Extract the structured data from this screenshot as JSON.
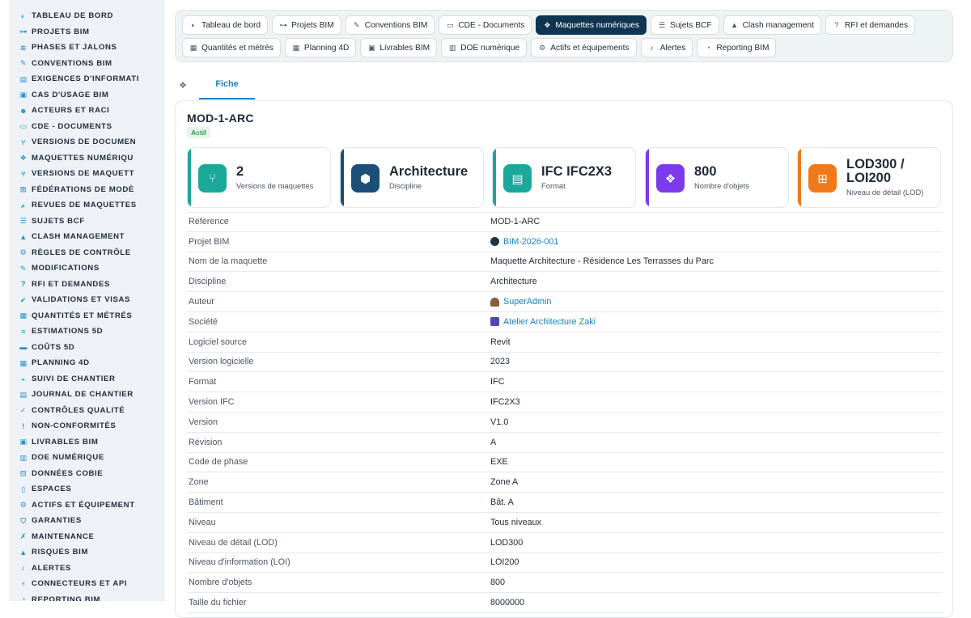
{
  "sidebar": {
    "items": [
      {
        "label": "TABLEAU DE BORD",
        "icon": "dashboard-icon",
        "glyph": "◐"
      },
      {
        "label": "PROJETS BIM",
        "icon": "project-tree-icon",
        "glyph": "⊶"
      },
      {
        "label": "PHASES ET JALONS",
        "icon": "layers-icon",
        "glyph": "≋"
      },
      {
        "label": "CONVENTIONS BIM",
        "icon": "document-sign-icon",
        "glyph": "✎"
      },
      {
        "label": "EXIGENCES D'INFORMATI",
        "icon": "clipboard-icon",
        "glyph": "▤"
      },
      {
        "label": "CAS D'USAGE BIM",
        "icon": "folder-icon",
        "glyph": "▣"
      },
      {
        "label": "ACTEURS ET RACI",
        "icon": "users-icon",
        "glyph": "☻"
      },
      {
        "label": "CDE - DOCUMENTS",
        "icon": "folder-open-icon",
        "glyph": "▭"
      },
      {
        "label": "VERSIONS DE DOCUMEN",
        "icon": "branch-icon",
        "glyph": "⑂"
      },
      {
        "label": "MAQUETTES NUMÉRIQU",
        "icon": "cubes-icon",
        "glyph": "❖"
      },
      {
        "label": "VERSIONS DE MAQUETT",
        "icon": "branch-icon",
        "glyph": "⑂"
      },
      {
        "label": "FÉDÉRATIONS DE MODÈ",
        "icon": "sitemap-icon",
        "glyph": "⊞"
      },
      {
        "label": "REVUES DE MAQUETTES",
        "icon": "search-icon",
        "glyph": "⌕"
      },
      {
        "label": "SUJETS BCF",
        "icon": "comments-icon",
        "glyph": "☰"
      },
      {
        "label": "CLASH MANAGEMENT",
        "icon": "warning-icon",
        "glyph": "▲"
      },
      {
        "label": "RÈGLES DE CONTRÔLE",
        "icon": "cogs-icon",
        "glyph": "⚙"
      },
      {
        "label": "MODIFICATIONS",
        "icon": "edit-icon",
        "glyph": "✎"
      },
      {
        "label": "RFI ET DEMANDES",
        "icon": "question-icon",
        "glyph": "?"
      },
      {
        "label": "VALIDATIONS ET VISAS",
        "icon": "check-double-icon",
        "glyph": "✔"
      },
      {
        "label": "QUANTITÉS ET MÉTRÉS",
        "icon": "calculator-icon",
        "glyph": "▦"
      },
      {
        "label": "ESTIMATIONS 5D",
        "icon": "list-icon",
        "glyph": "≡"
      },
      {
        "label": "COÛTS 5D",
        "icon": "money-icon",
        "glyph": "▬"
      },
      {
        "label": "PLANNING 4D",
        "icon": "calendar-icon",
        "glyph": "▦"
      },
      {
        "label": "SUIVI DE CHANTIER",
        "icon": "helmet-icon",
        "glyph": "◒"
      },
      {
        "label": "JOURNAL DE CHANTIER",
        "icon": "book-icon",
        "glyph": "▤"
      },
      {
        "label": "CONTRÔLES QUALITÉ",
        "icon": "check-circle-icon",
        "glyph": "✓"
      },
      {
        "label": "NON-CONFORMITÉS",
        "icon": "exclamation-circle-icon",
        "glyph": "!"
      },
      {
        "label": "LIVRABLES BIM",
        "icon": "box-icon",
        "glyph": "▣"
      },
      {
        "label": "DOE NUMÉRIQUE",
        "icon": "book-open-icon",
        "glyph": "▥"
      },
      {
        "label": "DONNÉES COBIE",
        "icon": "table-icon",
        "glyph": "⊟"
      },
      {
        "label": "ESPACES",
        "icon": "door-icon",
        "glyph": "▯"
      },
      {
        "label": "ACTIFS ET ÉQUIPEMENT",
        "icon": "cogs-icon",
        "glyph": "⚙"
      },
      {
        "label": "GARANTIES",
        "icon": "shield-icon",
        "glyph": "⛉"
      },
      {
        "label": "MAINTENANCE",
        "icon": "wrench-icon",
        "glyph": "✗"
      },
      {
        "label": "RISQUES BIM",
        "icon": "warning-icon",
        "glyph": "▲"
      },
      {
        "label": "ALERTES",
        "icon": "bell-icon",
        "glyph": "♪"
      },
      {
        "label": "CONNECTEURS ET API",
        "icon": "plug-icon",
        "glyph": "⚡"
      },
      {
        "label": "REPORTING BIM",
        "icon": "chart-pie-icon",
        "glyph": "◔"
      }
    ]
  },
  "tabs": {
    "row1": [
      {
        "label": "Tableau de bord",
        "icon": "dashboard-icon",
        "glyph": "◐"
      },
      {
        "label": "Projets BIM",
        "icon": "project-tree-icon",
        "glyph": "⊶"
      },
      {
        "label": "Conventions BIM",
        "icon": "document-sign-icon",
        "glyph": "✎"
      },
      {
        "label": "CDE - Documents",
        "icon": "folder-open-icon",
        "glyph": "▭"
      },
      {
        "label": "Maquettes numériques",
        "icon": "cubes-icon",
        "glyph": "❖",
        "active": true
      },
      {
        "label": "Sujets BCF",
        "icon": "comments-icon",
        "glyph": "☰"
      },
      {
        "label": "Clash management",
        "icon": "warning-icon",
        "glyph": "▲"
      },
      {
        "label": "RFI et demandes",
        "icon": "question-icon",
        "glyph": "?"
      }
    ],
    "row2": [
      {
        "label": "Quantités et métrés",
        "icon": "calculator-icon",
        "glyph": "▦"
      },
      {
        "label": "Planning 4D",
        "icon": "calendar-icon",
        "glyph": "▦"
      },
      {
        "label": "Livrables BIM",
        "icon": "box-icon",
        "glyph": "▣"
      },
      {
        "label": "DOE numérique",
        "icon": "book-open-icon",
        "glyph": "▥"
      },
      {
        "label": "Actifs et équipements",
        "icon": "cogs-icon",
        "glyph": "⚙"
      },
      {
        "label": "Alertes",
        "icon": "bell-icon",
        "glyph": "♪"
      },
      {
        "label": "Reporting BIM",
        "icon": "chart-pie-icon",
        "glyph": "◔"
      }
    ]
  },
  "subtab": {
    "label": "Fiche"
  },
  "model": {
    "title": "MOD-1-ARC",
    "status": "Actif"
  },
  "kpis": [
    {
      "value": "2",
      "label": "Versions de maquettes",
      "icon": "branch-icon",
      "glyph": "⑂",
      "color": "#1aa89a"
    },
    {
      "value": "Architecture",
      "label": "Discipline",
      "icon": "cube-icon",
      "glyph": "⬢",
      "color": "#1c4f78"
    },
    {
      "value": "IFC IFC2X3",
      "label": "Format",
      "icon": "file-code-icon",
      "glyph": "▤",
      "color": "#1aa89a"
    },
    {
      "value": "800",
      "label": "Nombre d'objets",
      "icon": "cubes-icon",
      "glyph": "❖",
      "color": "#7c3aed"
    },
    {
      "value": "LOD300 / LOI200",
      "label": "Niveau de détail (LOD)",
      "icon": "sitemap-icon",
      "glyph": "⊞",
      "color": "#f07a1a"
    }
  ],
  "details": [
    {
      "key": "Référence",
      "value": "MOD-1-ARC"
    },
    {
      "key": "Projet BIM",
      "value": "BIM-2026-001",
      "link": true,
      "icon": "project-avatar-icon"
    },
    {
      "key": "Nom de la maquette",
      "value": "Maquette Architecture - Résidence Les Terrasses du Parc"
    },
    {
      "key": "Discipline",
      "value": "Architecture"
    },
    {
      "key": "Auteur",
      "value": "SuperAdmin",
      "link": true,
      "icon": "user-icon"
    },
    {
      "key": "Société",
      "value": "Atelier Architecture Zaki",
      "link": true,
      "icon": "building-icon"
    },
    {
      "key": "Logiciel source",
      "value": "Revit"
    },
    {
      "key": "Version logicielle",
      "value": "2023"
    },
    {
      "key": "Format",
      "value": "IFC"
    },
    {
      "key": "Version IFC",
      "value": "IFC2X3"
    },
    {
      "key": "Version",
      "value": "V1.0"
    },
    {
      "key": "Révision",
      "value": "A"
    },
    {
      "key": "Code de phase",
      "value": "EXE"
    },
    {
      "key": "Zone",
      "value": "Zone A"
    },
    {
      "key": "Bâtiment",
      "value": "Bât. A"
    },
    {
      "key": "Niveau",
      "value": "Tous niveaux"
    },
    {
      "key": "Niveau de détail (LOD)",
      "value": "LOD300"
    },
    {
      "key": "Niveau d'information (LOI)",
      "value": "LOI200"
    },
    {
      "key": "Nombre d'objets",
      "value": "800"
    },
    {
      "key": "Taille du fichier",
      "value": "8000000"
    }
  ]
}
